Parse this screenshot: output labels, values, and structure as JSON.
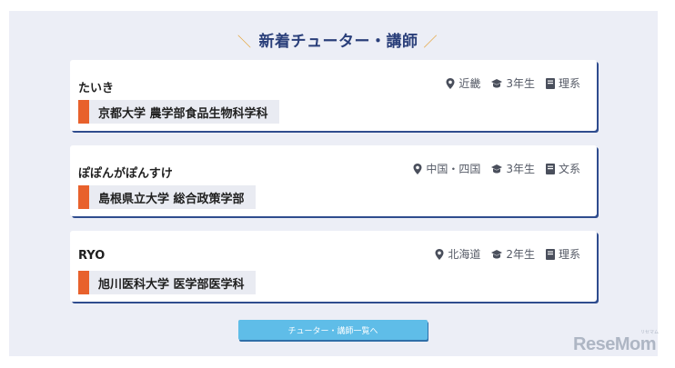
{
  "section": {
    "title": "新着チューター・講師",
    "deco_left": "＼",
    "deco_right": "／"
  },
  "tutors": [
    {
      "name": "たいき",
      "region": "近畿",
      "grade": "3年生",
      "field": "理系",
      "school": "京都大学 農学部食品生物科学科"
    },
    {
      "name": "ぽぽんがぽんすけ",
      "region": "中国・四国",
      "grade": "3年生",
      "field": "文系",
      "school": "島根県立大学 総合政策学部"
    },
    {
      "name": "RYO",
      "region": "北海道",
      "grade": "2年生",
      "field": "理系",
      "school": "旭川医科大学 医学部医学科"
    }
  ],
  "icons": {
    "region": "location-pin-icon",
    "grade": "graduation-cap-icon",
    "field": "book-icon"
  },
  "more_button_label": "チューター・講師一覧へ",
  "watermark": {
    "brand": "ReseMom",
    "small": "リセマム"
  },
  "colors": {
    "accent": "#e8612c",
    "title": "#2a3f7a",
    "button": "#5fbde8",
    "card_shadow": "#2f4c8e"
  }
}
